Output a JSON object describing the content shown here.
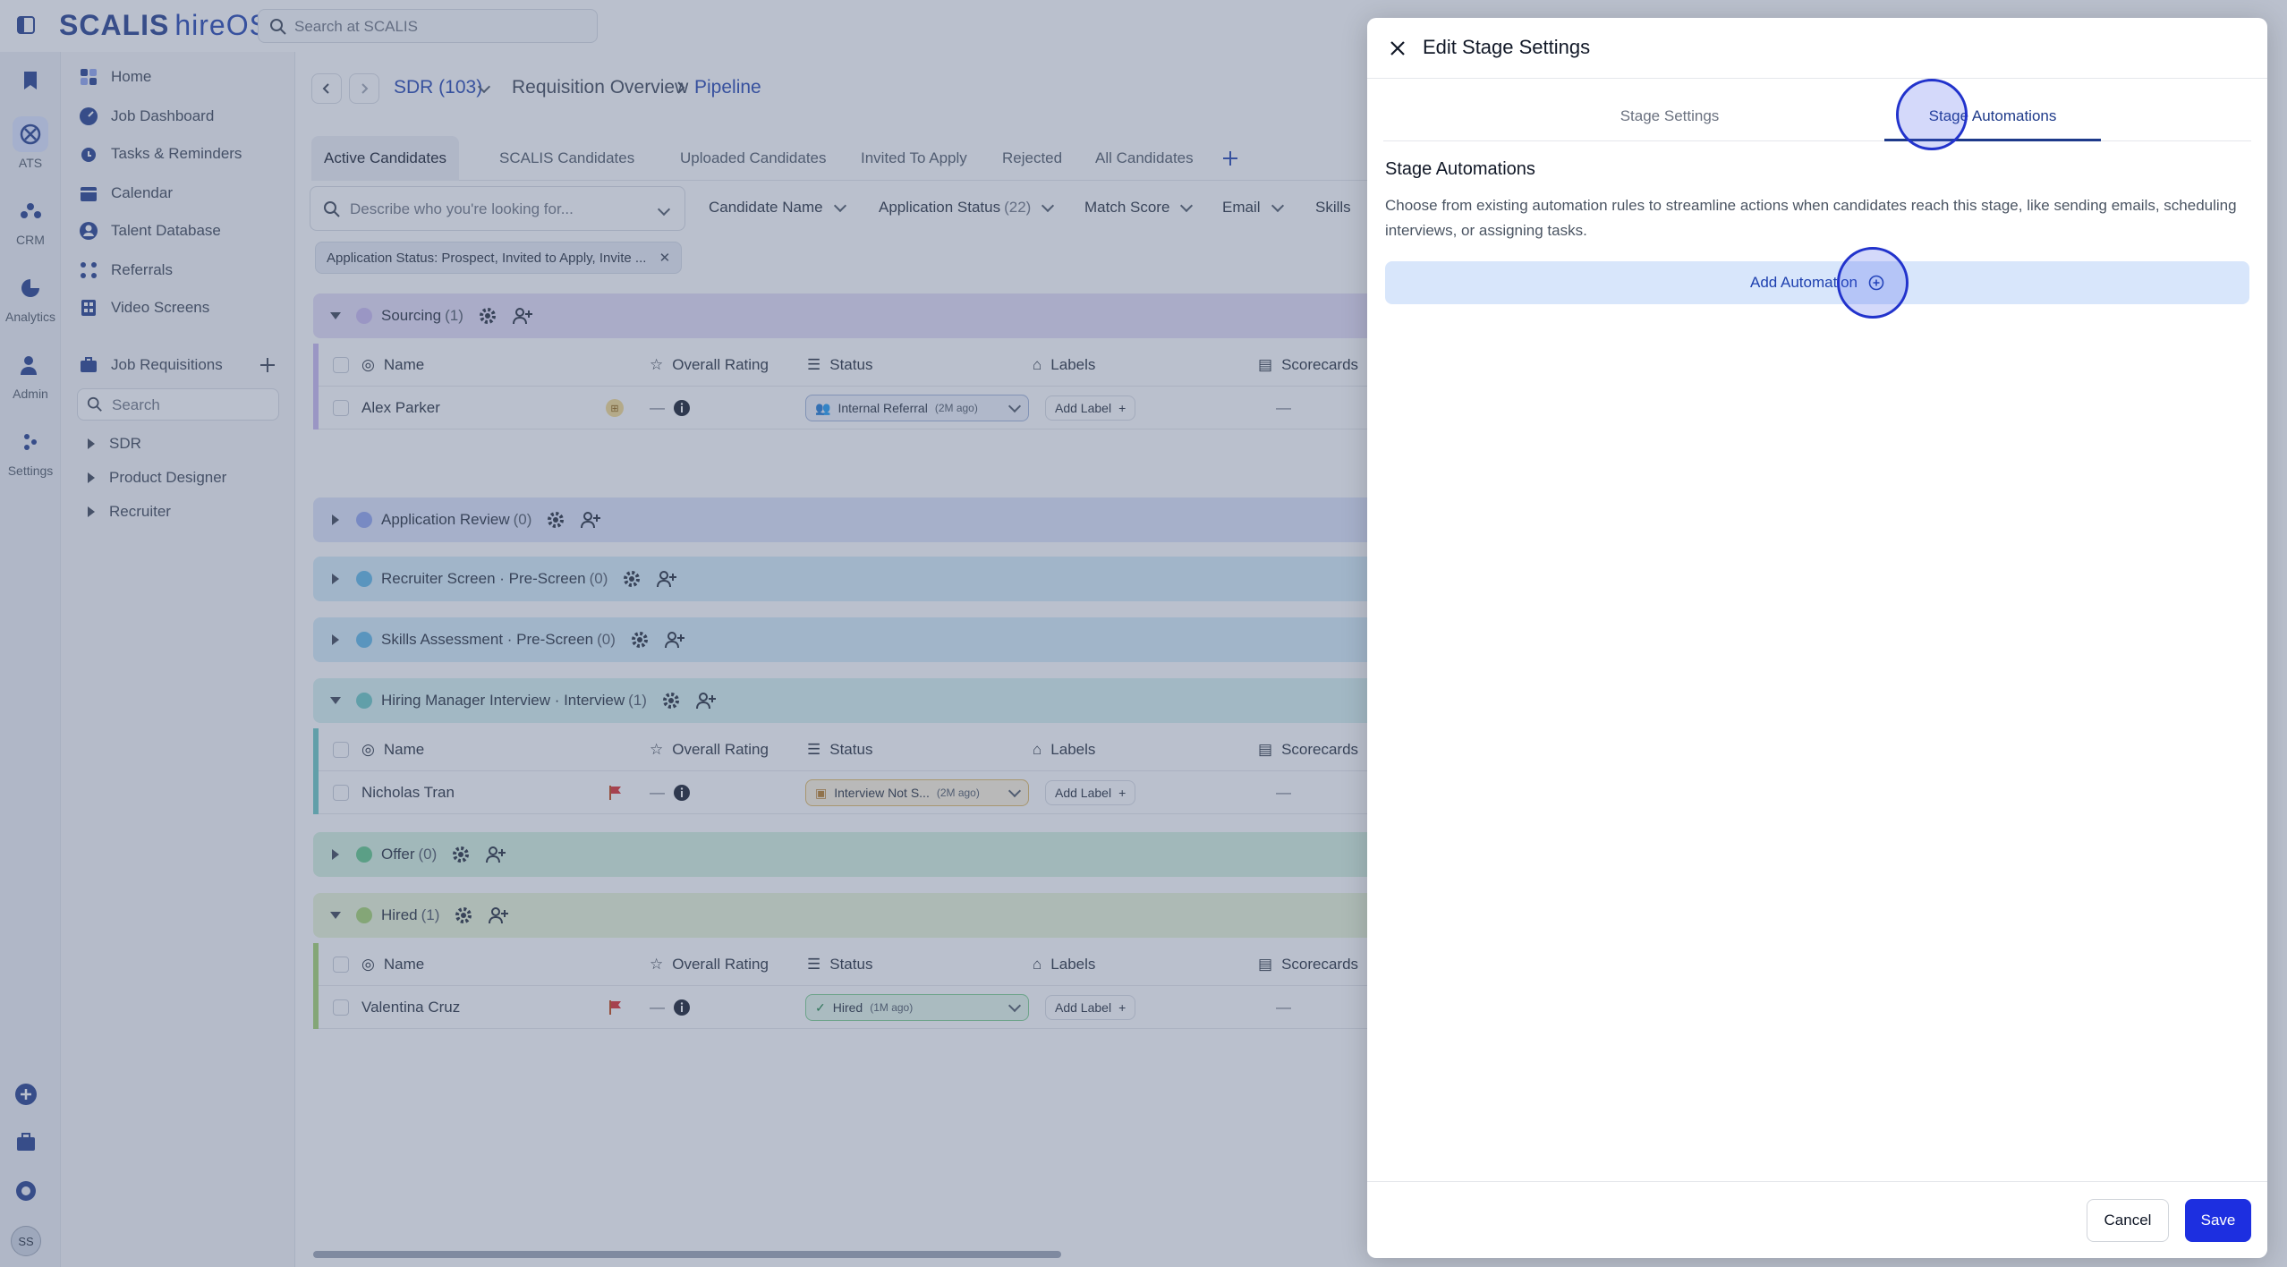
{
  "brand": {
    "name": "SCALIS",
    "product": "hireOS"
  },
  "top_search": {
    "placeholder": "Search at SCALIS"
  },
  "rail": [
    {
      "label": "",
      "icon": "bookmark-icon"
    },
    {
      "label": "ATS",
      "icon": "ats-icon"
    },
    {
      "label": "CRM",
      "icon": "crm-icon"
    },
    {
      "label": "Analytics",
      "icon": "analytics-icon"
    },
    {
      "label": "Admin",
      "icon": "admin-icon"
    },
    {
      "label": "Settings",
      "icon": "settings-icon"
    }
  ],
  "rail_bottom": {
    "avatar_initials": "SS"
  },
  "sidenav": {
    "items": [
      {
        "label": "Home"
      },
      {
        "label": "Job Dashboard"
      },
      {
        "label": "Tasks & Reminders"
      },
      {
        "label": "Calendar"
      },
      {
        "label": "Talent Database"
      },
      {
        "label": "Referrals"
      },
      {
        "label": "Video Screens"
      }
    ],
    "job_requisitions": "Job Requisitions",
    "search_placeholder": "Search",
    "tree": [
      {
        "label": "SDR"
      },
      {
        "label": "Product Designer"
      },
      {
        "label": "Recruiter"
      }
    ]
  },
  "breadcrumb": {
    "job": "SDR (103)",
    "overview": "Requisition Overview",
    "current": "Pipeline"
  },
  "tabs": [
    {
      "label": "Active Candidates"
    },
    {
      "label": "SCALIS Candidates"
    },
    {
      "label": "Uploaded Candidates"
    },
    {
      "label": "Invited To Apply"
    },
    {
      "label": "Rejected"
    },
    {
      "label": "All Candidates"
    }
  ],
  "filters": {
    "search_placeholder": "Describe who you're looking for...",
    "items": [
      {
        "label": "Candidate Name",
        "count": ""
      },
      {
        "label": "Application Status",
        "count": "(22)"
      },
      {
        "label": "Match Score",
        "count": ""
      },
      {
        "label": "Email",
        "count": ""
      },
      {
        "label": "Skills",
        "count": ""
      }
    ],
    "active_chip": "Application Status: Prospect, Invited to Apply, Invite ..."
  },
  "columns": {
    "name": "Name",
    "rating": "Overall Rating",
    "status": "Status",
    "labels": "Labels",
    "scorecards": "Scorecards"
  },
  "stages": [
    {
      "name": "Sourcing",
      "count": "(1)",
      "color": "#c8b7ef",
      "bar": "#e4dcf7"
    },
    {
      "name": "Application Review",
      "count": "(0)",
      "color": "#8ea2ee",
      "bar": "#dde4fa"
    },
    {
      "name": "Recruiter Screen · Pre-Screen",
      "count": "(0)",
      "color": "#5ab6e6",
      "bar": "#d5ecf8"
    },
    {
      "name": "Skills Assessment · Pre-Screen",
      "count": "(0)",
      "color": "#5ab6e6",
      "bar": "#d5ecf8"
    },
    {
      "name": "Hiring Manager Interview · Interview",
      "count": "(1)",
      "color": "#67c7c2",
      "bar": "#d6f1ef"
    },
    {
      "name": "Offer",
      "count": "(0)",
      "color": "#5cc785",
      "bar": "#d5f1df"
    },
    {
      "name": "Hired",
      "count": "(1)",
      "color": "#a3d26b",
      "bar": "#e9f5d6"
    }
  ],
  "rows": [
    {
      "name": "Alex Parker",
      "rating": "—",
      "status": "Internal Referral",
      "status_age": "(2M ago)",
      "add_label": "Add Label",
      "scorecard": "—"
    },
    {
      "name": "Nicholas Tran",
      "rating": "—",
      "status": "Interview Not S...",
      "status_age": "(2M ago)",
      "add_label": "Add Label",
      "scorecard": "—"
    },
    {
      "name": "Valentina Cruz",
      "rating": "—",
      "status": "Hired",
      "status_age": "(1M ago)",
      "add_label": "Add Label",
      "scorecard": "—"
    }
  ],
  "panel": {
    "title": "Edit Stage Settings",
    "tabs": [
      {
        "label": "Stage Settings"
      },
      {
        "label": "Stage Automations"
      }
    ],
    "section_title": "Stage Automations",
    "section_desc": "Choose from existing automation rules to streamline actions when candidates reach this stage, like sending emails, scheduling interviews, or assigning tasks.",
    "add_automation": "Add Automation",
    "cancel": "Cancel",
    "save": "Save"
  }
}
